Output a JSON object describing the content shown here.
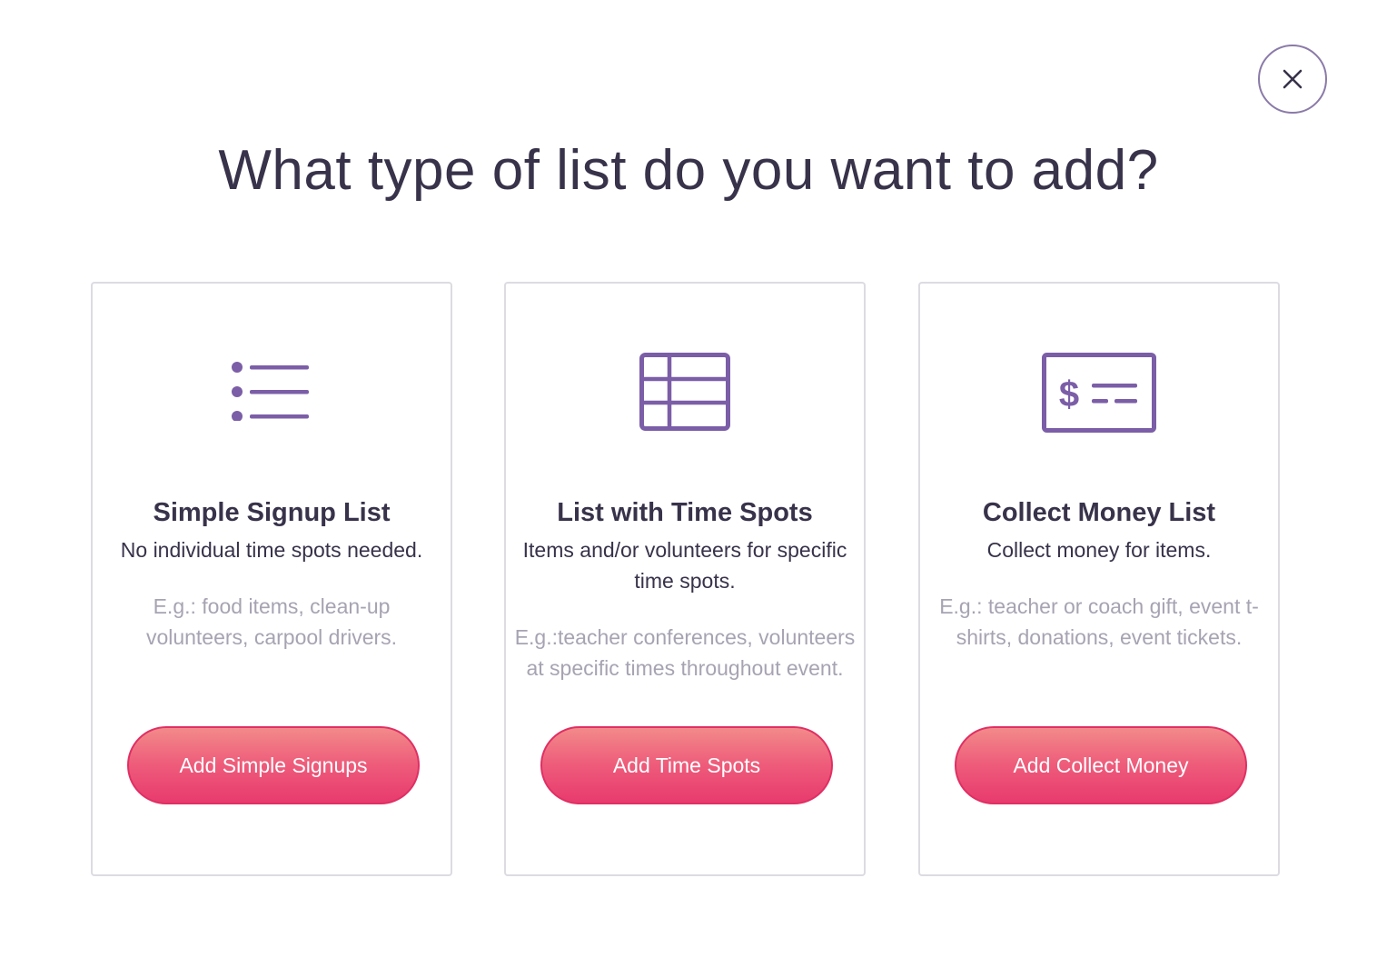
{
  "dialog": {
    "title": "What type of list do you want to add?",
    "close_icon": "close-icon"
  },
  "colors": {
    "accent_purple": "#7b5ea7",
    "title_text": "#38324a",
    "muted_text": "#a7a3b2",
    "button_gradient_top": "#f28a8a",
    "button_gradient_bottom": "#e83a6e"
  },
  "cards": [
    {
      "icon": "bulleted-list-icon",
      "title": "Simple Signup List",
      "description": "No individual time spots needed.",
      "example": "E.g.: food items, clean-up volunteers, carpool drivers.",
      "button_label": "Add Simple Signups"
    },
    {
      "icon": "table-grid-icon",
      "title": "List with Time Spots",
      "description": "Items and/or volunteers for specific time spots.",
      "example": "E.g.:teacher conferences, volunteers at specific times throughout event.",
      "button_label": "Add Time Spots"
    },
    {
      "icon": "money-check-icon",
      "title": "Collect Money List",
      "description": "Collect money for items.",
      "example": "E.g.: teacher or coach gift, event t-shirts, donations, event tickets.",
      "button_label": "Add Collect Money"
    }
  ]
}
